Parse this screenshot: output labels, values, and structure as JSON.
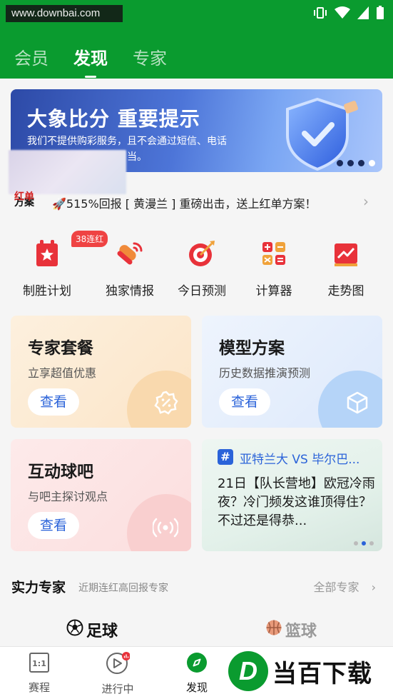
{
  "status_bar": {
    "watermark": "www.downbai.com"
  },
  "top_tabs": [
    {
      "label": "会员",
      "active": false
    },
    {
      "label": "发现",
      "active": true
    },
    {
      "label": "专家",
      "active": false
    }
  ],
  "banner": {
    "title": "大象比分 重要提示",
    "text": "我们不提供购彩服务，且不会通过短信、电话",
    "text2": "当。",
    "dots": 4,
    "active_dot": 3
  },
  "notice": {
    "label_top": "红单",
    "label": "方案",
    "text": "🚀515%回报 [ 黄漫兰 ] 重磅出击，送上红单方案！"
  },
  "quick_icons": [
    {
      "label": "制胜计划",
      "badge": "38连红"
    },
    {
      "label": "独家情报"
    },
    {
      "label": "今日预测"
    },
    {
      "label": "计算器"
    },
    {
      "label": "走势图"
    }
  ],
  "cards": {
    "expert_package": {
      "title": "专家套餐",
      "subtitle": "立享超值优惠",
      "button": "查看"
    },
    "model_plan": {
      "title": "模型方案",
      "subtitle": "历史数据推演预测",
      "button": "查看"
    },
    "forum": {
      "title": "互动球吧",
      "subtitle": "与吧主探讨观点",
      "button": "查看"
    },
    "news": {
      "title": "亚特兰大 VS 毕尔巴...",
      "body": "21日【队长营地】欧冠冷雨夜？冷门频发这谁顶得住？不过还是得恭..."
    }
  },
  "experts": {
    "title": "实力专家",
    "subtitle": "近期连红高回报专家",
    "all_link": "全部专家",
    "sports": [
      {
        "label": "足球",
        "active": true
      },
      {
        "label": "篮球",
        "active": false
      }
    ]
  },
  "bottom_nav": [
    {
      "label": "赛程",
      "icon": "schedule-icon"
    },
    {
      "label": "进行中",
      "icon": "play-icon"
    },
    {
      "label": "发现",
      "icon": "compass-icon",
      "active": true
    }
  ],
  "logo_watermark": {
    "letter": "D",
    "text": "当百下载"
  },
  "colors": {
    "brand_green": "#0a9b2f",
    "accent_blue": "#2b63d9",
    "badge_red": "#ef4343"
  }
}
